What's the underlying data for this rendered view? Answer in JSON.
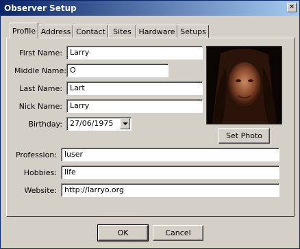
{
  "window": {
    "title": "Observer Setup"
  },
  "tabs": [
    "Profile",
    "Address",
    "Contact",
    "Sites",
    "Hardware",
    "Setups"
  ],
  "profile": {
    "first_name": {
      "label": "First Name:",
      "value": "Larry"
    },
    "middle_name": {
      "label": "Middle Name:",
      "value": "O"
    },
    "last_name": {
      "label": "Last Name:",
      "value": "Lart"
    },
    "nick_name": {
      "label": "Nick Name:",
      "value": "Larry"
    },
    "birthday": {
      "label": "Birthday:",
      "value": "27/06/1975"
    },
    "profession": {
      "label": "Profession:",
      "value": "luser"
    },
    "hobbies": {
      "label": "Hobbies:",
      "value": "life"
    },
    "website": {
      "label": "Website:",
      "value": "http://larryo.org"
    },
    "set_photo_label": "Set Photo"
  },
  "footer": {
    "ok_label": "OK",
    "cancel_label": "Cancel"
  },
  "icons": {
    "close": "close-icon",
    "dropdown": "chevron-down-icon"
  }
}
